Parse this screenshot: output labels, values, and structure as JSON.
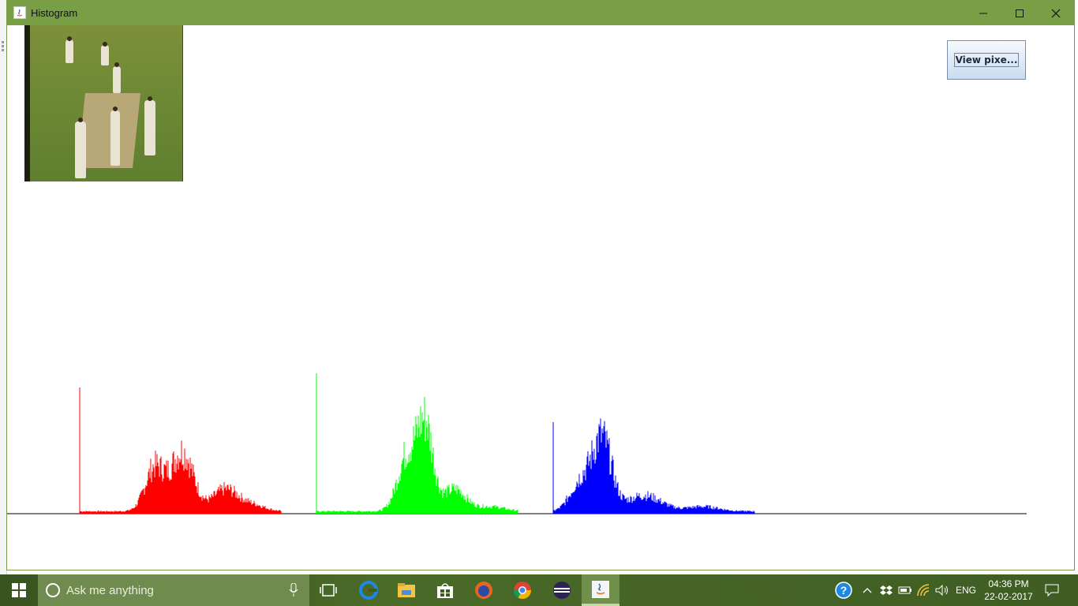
{
  "window": {
    "title": "Histogram"
  },
  "toolbar": {
    "view_pixels_label": "View pixe..."
  },
  "histogram": {
    "colors": {
      "red": "#ff0000",
      "green": "#00ff00",
      "blue": "#0000ff",
      "axis": "#000000"
    }
  },
  "taskbar": {
    "search_placeholder": "Ask me anything",
    "language": "ENG",
    "time": "04:36 PM",
    "date": "22-02-2017",
    "icons": [
      "task-view-icon",
      "edge-icon",
      "file-explorer-icon",
      "store-icon",
      "firefox-icon",
      "chrome-icon",
      "eclipse-icon",
      "java-icon"
    ]
  },
  "titlebar": {
    "accent": "#789f45"
  },
  "chart_data": {
    "type": "bar",
    "title": "",
    "series": [
      {
        "color": "#ff0000",
        "peaks": [
          {
            "bin": 0,
            "value": 160
          },
          {
            "bin": 128,
            "value": 92
          }
        ]
      },
      {
        "color": "#00ff00",
        "peaks": [
          {
            "bin": 0,
            "value": 178
          },
          {
            "bin": 135,
            "value": 132
          }
        ]
      },
      {
        "color": "#0000ff",
        "peaks": [
          {
            "bin": 0,
            "value": 116
          },
          {
            "bin": 64,
            "value": 118
          }
        ]
      }
    ]
  }
}
